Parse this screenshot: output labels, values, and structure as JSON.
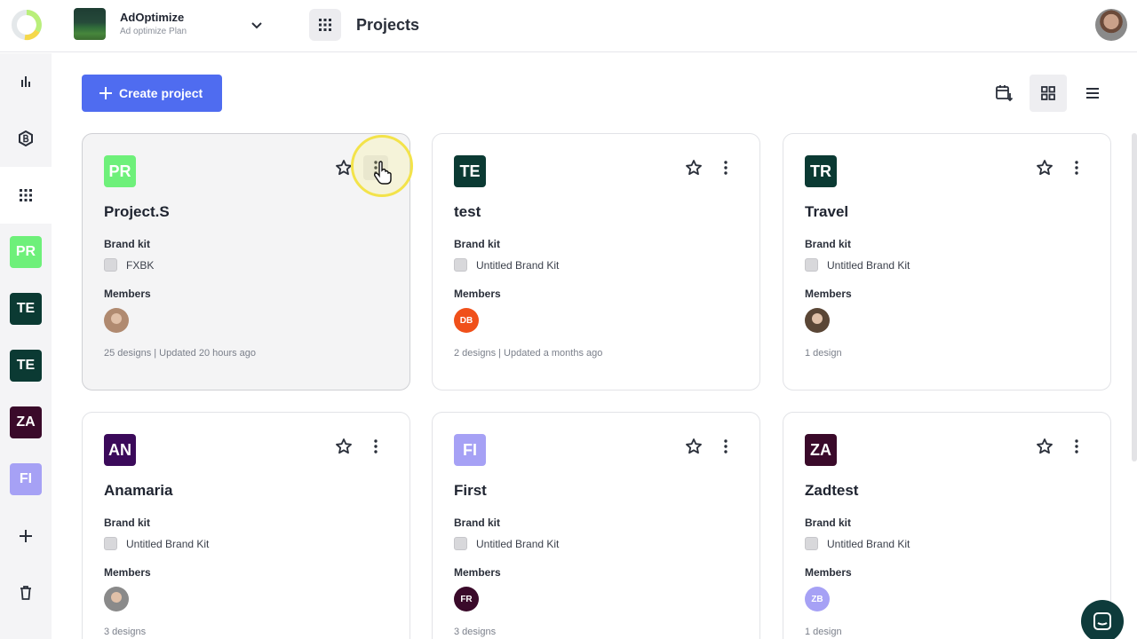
{
  "workspace": {
    "name": "AdOptimize",
    "plan": "Ad optimize Plan"
  },
  "header": {
    "title": "Projects"
  },
  "sidebar": {
    "nav": [
      {
        "icon": "analytics-icon"
      },
      {
        "icon": "brand-kit-icon"
      },
      {
        "icon": "apps-grid-icon"
      }
    ],
    "projects": [
      {
        "initials": "PR",
        "color": "#6ef07a"
      },
      {
        "initials": "TE",
        "color": "#0b3a33"
      },
      {
        "initials": "TE",
        "color": "#0b3a33"
      },
      {
        "initials": "ZA",
        "color": "#3a0a2a"
      },
      {
        "initials": "FI",
        "color": "#a6a1f5"
      }
    ]
  },
  "toolbar": {
    "create_label": "Create project"
  },
  "labels": {
    "brand_kit": "Brand kit",
    "members": "Members"
  },
  "projects": [
    {
      "initials": "PR",
      "color": "#6ef07a",
      "name": "Project.S",
      "brand_kit": "FXBK",
      "member": {
        "type": "photo",
        "text": "",
        "color": "#b08a70"
      },
      "meta": "25 designs | Updated 20 hours ago"
    },
    {
      "initials": "TE",
      "color": "#0b3a33",
      "name": "test",
      "brand_kit": "Untitled Brand Kit",
      "member": {
        "type": "initials",
        "text": "DB",
        "color": "#f0501a"
      },
      "meta": "2 designs | Updated a months ago"
    },
    {
      "initials": "TR",
      "color": "#0b3a33",
      "name": "Travel",
      "brand_kit": "Untitled Brand Kit",
      "member": {
        "type": "photo",
        "text": "",
        "color": "#5a4636"
      },
      "meta": "1 design"
    },
    {
      "initials": "AN",
      "color": "#3b0a5a",
      "name": "Anamaria",
      "brand_kit": "Untitled Brand Kit",
      "member": {
        "type": "photo",
        "text": "",
        "color": "#8a8a8a"
      },
      "meta": "3 designs"
    },
    {
      "initials": "FI",
      "color": "#a6a1f5",
      "name": "First",
      "brand_kit": "Untitled Brand Kit",
      "member": {
        "type": "initials",
        "text": "FR",
        "color": "#3a0a2a"
      },
      "meta": "3 designs"
    },
    {
      "initials": "ZA",
      "color": "#3a0a2a",
      "name": "Zadtest",
      "brand_kit": "Untitled Brand Kit",
      "member": {
        "type": "initials",
        "text": "ZB",
        "color": "#a6a1f5"
      },
      "meta": "1 design"
    }
  ]
}
